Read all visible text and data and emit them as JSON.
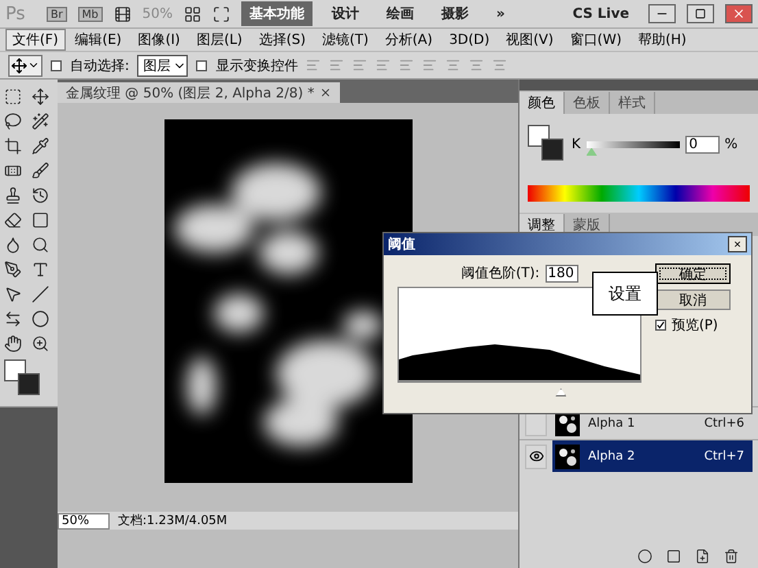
{
  "app_bar": {
    "logo": "Ps",
    "apps": [
      "Br",
      "Mb"
    ],
    "zoom": "50%",
    "workspaces": [
      {
        "label": "基本功能",
        "selected": true
      },
      {
        "label": "设计",
        "selected": false
      },
      {
        "label": "绘画",
        "selected": false
      },
      {
        "label": "摄影",
        "selected": false
      }
    ],
    "more": "»",
    "cs_live": "CS Live"
  },
  "menu": [
    {
      "label": "文件(F)",
      "selected": true
    },
    {
      "label": "编辑(E)",
      "selected": false
    },
    {
      "label": "图像(I)",
      "selected": false
    },
    {
      "label": "图层(L)",
      "selected": false
    },
    {
      "label": "选择(S)",
      "selected": false
    },
    {
      "label": "滤镜(T)",
      "selected": false
    },
    {
      "label": "分析(A)",
      "selected": false
    },
    {
      "label": "3D(D)",
      "selected": false
    },
    {
      "label": "视图(V)",
      "selected": false
    },
    {
      "label": "窗口(W)",
      "selected": false
    },
    {
      "label": "帮助(H)",
      "selected": false
    }
  ],
  "options": {
    "auto_select": {
      "label": "自动选择:",
      "checked": false
    },
    "auto_select_value": "图层",
    "transform": {
      "label": "显示变换控件",
      "checked": false
    }
  },
  "document": {
    "tab": "金属纹理 @ 50% (图层 2, Alpha 2/8) *",
    "zoom": "50%",
    "info": "文档:1.23M/4.05M"
  },
  "color_panel": {
    "tabs": [
      {
        "label": "颜色",
        "selected": true
      },
      {
        "label": "色板",
        "selected": false
      },
      {
        "label": "样式",
        "selected": false
      }
    ],
    "channel": "K",
    "level": 0,
    "value": "0",
    "unit": "%"
  },
  "channels_panel": {
    "tabs": [
      {
        "label": "调整",
        "selected": true
      },
      {
        "label": "蒙版",
        "selected": false
      }
    ],
    "rows": [
      {
        "name": "Alpha 1",
        "shortcut": "Ctrl+6",
        "visible": false,
        "selected": false
      },
      {
        "name": "Alpha 2",
        "shortcut": "Ctrl+7",
        "visible": true,
        "selected": true
      }
    ]
  },
  "dialog": {
    "title": "阈值",
    "close": "×",
    "label": "阈值色阶(T):",
    "value": "180",
    "buttons": [
      {
        "label": "确定",
        "default": true
      },
      {
        "label": "取消",
        "default": false
      }
    ],
    "preview": {
      "label": "预览(P)",
      "checked": true
    },
    "level": 0.67
  },
  "callout": "设置"
}
